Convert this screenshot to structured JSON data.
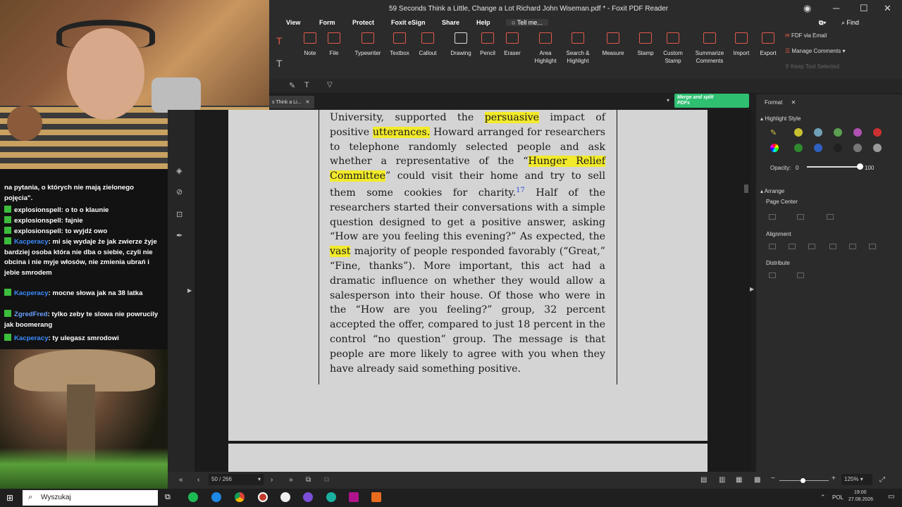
{
  "app": {
    "window_title": "59 Seconds Think a Little, Change a Lot Richard John Wiseman.pdf * - Foxit PDF Reader",
    "menu": [
      "View",
      "Form",
      "Protect",
      "Foxit eSign",
      "Share",
      "Help"
    ],
    "tell_me": "Tell me...",
    "find": "Find",
    "ribbon": [
      "Note",
      "File",
      "Typewriter",
      "Textbox",
      "Callout",
      "Drawing",
      "Pencil",
      "Eraser",
      "Area Highlight",
      "Search & Highlight",
      "Measure",
      "Stamp",
      "Custom Stamp",
      "Summarize Comments",
      "Import",
      "Export"
    ],
    "ribbon_right": [
      "FDF via Email",
      "Manage Comments",
      "Keep Tool Selected"
    ],
    "tab_label": "s Think a Li...",
    "merge_banner": "Merge and split PDFs"
  },
  "document": {
    "lines": [
      "University, supported the persuasive impact of positive utterances. Howard arranged for researchers to telephone randomly selected people and ask whether a representative of the “Hunger Relief Committee” could visit their home and try to sell them some cookies for charity.",
      "Half of the researchers started their conversations with a simple question designed to get a positive answer, asking “How are you feeling this evening?” As expected, the vast majority of people responded favorably (“Great,” “Fine, thanks”). More important, this act had a dramatic influence on whether they would allow a salesperson into their house. Of those who were in the “How are you feeling?” group, 32 percent accepted the offer, compared to just 18 percent in the control “no question” group. The message is that people are more likely to agree with you when they have already said something positive."
    ],
    "seg": {
      "a": "University, supported the ",
      "h1": "persuasive",
      "b": " impact of positive ",
      "h2": "utterances.",
      "c": " Howard arranged for researchers to telephone randomly selected people and ask whether a representative of the “",
      "h3": "Hunger Relief Committee",
      "d": "” could visit their home and try to sell them some cookies for charity.",
      "fn": "17",
      "e": " Half of the researchers started their conversations with a simple question designed to get a positive answer, asking “How are you feeling this evening?” As expected, the ",
      "h4": "vast",
      "f": " majority of people responded favorably (“Great,” “Fine, thanks”). More important, this act had a dramatic influence on whether they would allow a salesperson into their house. Of those who were in the “How are you feeling?” group, 32 percent accepted the offer, compared to just 18 percent in the control “no question” group. The message is that people are more likely to agree with you when they have already said something positive."
    }
  },
  "format_panel": {
    "tab": "Format",
    "highlight_style": "Highlight Style",
    "opacity_label": "Opacity:",
    "opacity_min": "0",
    "opacity_max": "100",
    "opacity_value": 100,
    "arrange": "Arrange",
    "page_center": "Page Center",
    "alignment": "Alignment",
    "distribute": "Distribute",
    "swatch_colors": [
      "#c8c030",
      "#6fa0b8",
      "#5aa050",
      "#b050b0",
      "#cc3030",
      "#2f8a2f",
      "#3060c0",
      "#202020",
      "#777777",
      "#9a9a9a"
    ]
  },
  "status": {
    "page": "50 / 266",
    "zoom": "125%"
  },
  "taskbar": {
    "search": "Wyszukaj",
    "lang": "POL",
    "time": "19:00",
    "date": "27.08.2026"
  },
  "chat": {
    "messages": [
      {
        "user": "",
        "text": "na pytania, o których nie mają zielonego pojęcia\"."
      },
      {
        "user": "explosionspell",
        "text": "o to o klaunie"
      },
      {
        "user": "explosionspell",
        "text": "fajnie"
      },
      {
        "user": "explosionspell",
        "text": "to wyjdź owo"
      },
      {
        "user": "Kacperacy",
        "text": "mi się wydaje że jak zwierze żyje bardziej osoba która nie dba o siebie, czyli nie obcina i nie myje włosów, nie zmienia ubrań i jebie smrodem"
      },
      {
        "user": "Kacperacy",
        "text": "mocne słowa jak na 38 latka"
      },
      {
        "user": "ZgredFred",
        "text": "tylko zeby te slowa nie powrucily jak boomerang"
      },
      {
        "user": "Kacperacy",
        "text": "ty ulegasz smrodowi"
      }
    ],
    "user_colors": {
      "Kacperacy": "#3b8cff",
      "ZgredFred": "#6aa0ff",
      "explosionspell": "#ffffff"
    }
  }
}
